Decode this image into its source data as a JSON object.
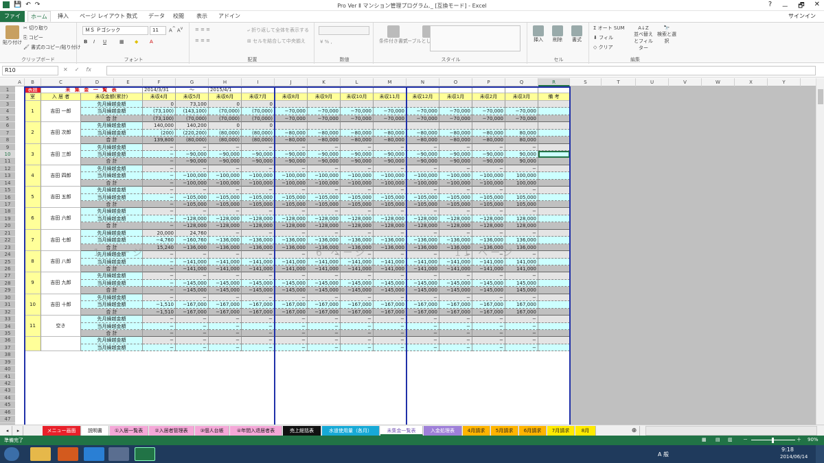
{
  "window": {
    "title": "Pro Ver Ⅱ マンション管理プログラム._ [互換モード] - Excel",
    "signin": "サインイン",
    "min": "－",
    "restore": "🗗",
    "close": "✕",
    "help": "?"
  },
  "ribbon_tabs": [
    "ファイル",
    "ホーム",
    "挿入",
    "ページ レイアウト",
    "数式",
    "データ",
    "校閲",
    "表示",
    "アドイン"
  ],
  "ribbon": {
    "paste": "貼り付け",
    "cut": "切り取り",
    "copy": "コピー",
    "format_painter": "書式のコピー/貼り付け",
    "clipboard": "クリップボード",
    "font_name": "ＭＳ Ｐゴシック",
    "font_size": "11",
    "font": "フォント",
    "wrap": "折り返して全体を表示する",
    "merge": "セルを結合して中央揃え",
    "alignment": "配置",
    "number": "数値",
    "cond_format": "条件付き書式",
    "table_format": "テーブルとして書式設定",
    "style": "スタイル",
    "insert": "挿入",
    "delete": "削除",
    "format": "書式",
    "cells": "セル",
    "autosum": "オート SUM",
    "fill": "フィル",
    "clear": "クリア",
    "sort": "並べ替えとフィルター",
    "find": "検索と選択",
    "editing": "編集"
  },
  "formula_bar": {
    "namebox": "R10",
    "fx": "fx",
    "formula": ""
  },
  "columns": [
    "A",
    "B",
    "C",
    "D",
    "E",
    "F",
    "G",
    "H",
    "I",
    "J",
    "K",
    "L",
    "M",
    "N",
    "O",
    "P",
    "Q",
    "R",
    "S",
    "T",
    "U",
    "V",
    "W",
    "X",
    "Y"
  ],
  "selected_column": "R",
  "selected_row": "10",
  "sheet": {
    "title_mark": "表題",
    "title": "未 集 金 一 覧 表",
    "date_from": "2014/3/31",
    "tilde": "～",
    "date_to": "2015/4/1",
    "hdr_room": "室",
    "hdr_resident": "入 居 者",
    "hdr_amount": "未収金額(累計)",
    "hdr_months": [
      "未収4月",
      "未収5月",
      "未収6月",
      "未収7月",
      "未収8月",
      "未収9月",
      "未収10月",
      "未収11月",
      "未収12月",
      "未収1月",
      "未収2月",
      "未収3月"
    ],
    "hdr_note": "備 考",
    "label_prev": "先月繰越金額",
    "label_curr": "当月繰越金額",
    "label_total": "合 計",
    "watermarks": [
      "1 ページ",
      "6 ページ",
      "11 ページ"
    ],
    "groups": [
      {
        "room": "1",
        "name": "吉田 一郎",
        "rows": [
          [
            "0",
            "73,100",
            "0",
            "0",
            "",
            "",
            "",
            "",
            "",
            "",
            "",
            ""
          ],
          [
            "(73,100)",
            "(143,100)",
            "(70,000)",
            "(70,000)",
            "−70,000",
            "−70,000",
            "−70,000",
            "−70,000",
            "−70,000",
            "−70,000",
            "−70,000",
            "−70,000"
          ],
          [
            "(73,100)",
            "(70,000)",
            "(70,000)",
            "(70,000)",
            "−70,000",
            "−70,000",
            "−70,000",
            "−70,000",
            "−70,000",
            "−70,000",
            "−70,000",
            "−70,000"
          ]
        ]
      },
      {
        "room": "2",
        "name": "吉田 次郎",
        "rows": [
          [
            "140,000",
            "140,200",
            "0",
            "0",
            "",
            "",
            "",
            "",
            "",
            "",
            "",
            ""
          ],
          [
            "(200)",
            "(220,200)",
            "(80,000)",
            "(80,000)",
            "−80,000",
            "−80,000",
            "−80,000",
            "−80,000",
            "−80,000",
            "−80,000",
            "−80,000",
            "80,000"
          ],
          [
            "139,800",
            "(80,000)",
            "(80,000)",
            "(80,000)",
            "−80,000",
            "−80,000",
            "−80,000",
            "−80,000",
            "−80,000",
            "−80,000",
            "−80,000",
            "80,000"
          ]
        ]
      },
      {
        "room": "3",
        "name": "吉田 三郎",
        "rows": [
          [
            "−",
            "−",
            "−",
            "−",
            "−",
            "−",
            "−",
            "−",
            "−",
            "−",
            "−",
            "−"
          ],
          [
            "−",
            "−90,000",
            "−90,000",
            "−90,000",
            "−90,000",
            "−90,000",
            "−90,000",
            "−90,000",
            "−90,000",
            "−90,000",
            "−90,000",
            "90,000"
          ],
          [
            "−",
            "−90,000",
            "−90,000",
            "−90,000",
            "−90,000",
            "−90,000",
            "−90,000",
            "−90,000",
            "−90,000",
            "−90,000",
            "−90,000",
            "90,000"
          ]
        ]
      },
      {
        "room": "4",
        "name": "吉田 四郎",
        "rows": [
          [
            "−",
            "−",
            "−",
            "−",
            "−",
            "−",
            "−",
            "−",
            "−",
            "−",
            "−",
            "−"
          ],
          [
            "−",
            "−100,000",
            "−100,000",
            "−100,000",
            "−100,000",
            "−100,000",
            "−100,000",
            "−100,000",
            "−100,000",
            "−100,000",
            "−100,000",
            "100,000"
          ],
          [
            "−",
            "−100,000",
            "−100,000",
            "−100,000",
            "−100,000",
            "−100,000",
            "−100,000",
            "−100,000",
            "−100,000",
            "−100,000",
            "−100,000",
            "100,000"
          ]
        ]
      },
      {
        "room": "5",
        "name": "吉田 五郎",
        "rows": [
          [
            "−",
            "−",
            "−",
            "−",
            "−",
            "−",
            "−",
            "−",
            "−",
            "−",
            "−",
            "−"
          ],
          [
            "−",
            "−105,000",
            "−105,000",
            "−105,000",
            "−105,000",
            "−105,000",
            "−105,000",
            "−105,000",
            "−105,000",
            "−105,000",
            "−105,000",
            "105,000"
          ],
          [
            "−",
            "−105,000",
            "−105,000",
            "−105,000",
            "−105,000",
            "−105,000",
            "−105,000",
            "−105,000",
            "−105,000",
            "−105,000",
            "−105,000",
            "105,000"
          ]
        ]
      },
      {
        "room": "6",
        "name": "吉田 六郎",
        "rows": [
          [
            "−",
            "−",
            "−",
            "−",
            "−",
            "−",
            "−",
            "−",
            "−",
            "−",
            "−",
            "−"
          ],
          [
            "−",
            "−128,000",
            "−128,000",
            "−128,000",
            "−128,000",
            "−128,000",
            "−128,000",
            "−128,000",
            "−128,000",
            "−128,000",
            "−128,000",
            "128,000"
          ],
          [
            "−",
            "−128,000",
            "−128,000",
            "−128,000",
            "−128,000",
            "−128,000",
            "−128,000",
            "−128,000",
            "−128,000",
            "−128,000",
            "−128,000",
            "128,000"
          ]
        ]
      },
      {
        "room": "7",
        "name": "吉田 七郎",
        "rows": [
          [
            "20,000",
            "24,760",
            "−",
            "−",
            "−",
            "−",
            "−",
            "−",
            "−",
            "−",
            "−",
            "−"
          ],
          [
            "−4,760",
            "−160,760",
            "−136,000",
            "−136,000",
            "−136,000",
            "−136,000",
            "−136,000",
            "−136,000",
            "−136,000",
            "−136,000",
            "−136,000",
            "136,000"
          ],
          [
            "15,240",
            "−136,000",
            "−136,000",
            "−136,000",
            "−136,000",
            "−136,000",
            "−136,000",
            "−136,000",
            "−136,000",
            "−136,000",
            "−136,000",
            "136,000"
          ]
        ]
      },
      {
        "room": "8",
        "name": "吉田 八郎",
        "rows": [
          [
            "−",
            "−",
            "−",
            "−",
            "−",
            "−",
            "−",
            "−",
            "−",
            "−",
            "−",
            "−"
          ],
          [
            "−",
            "−141,000",
            "−141,000",
            "−141,000",
            "−141,000",
            "−141,000",
            "−141,000",
            "−141,000",
            "−141,000",
            "−141,000",
            "−141,000",
            "141,000"
          ],
          [
            "−",
            "−141,000",
            "−141,000",
            "−141,000",
            "−141,000",
            "−141,000",
            "−141,000",
            "−141,000",
            "−141,000",
            "−141,000",
            "−141,000",
            "141,000"
          ]
        ]
      },
      {
        "room": "9",
        "name": "吉田 九郎",
        "rows": [
          [
            "−",
            "−",
            "−",
            "−",
            "−",
            "−",
            "−",
            "−",
            "−",
            "−",
            "−",
            "−"
          ],
          [
            "−",
            "−145,000",
            "−145,000",
            "−145,000",
            "−145,000",
            "−145,000",
            "−145,000",
            "−145,000",
            "−145,000",
            "−145,000",
            "−145,000",
            "145,000"
          ],
          [
            "−",
            "−145,000",
            "−145,000",
            "−145,000",
            "−145,000",
            "−145,000",
            "−145,000",
            "−145,000",
            "−145,000",
            "−145,000",
            "−145,000",
            "145,000"
          ]
        ]
      },
      {
        "room": "10",
        "name": "吉田 十郎",
        "rows": [
          [
            "−",
            "−",
            "−",
            "−",
            "−",
            "−",
            "−",
            "−",
            "−",
            "−",
            "−",
            "−"
          ],
          [
            "−1,510",
            "−167,000",
            "−167,000",
            "−167,000",
            "−167,000",
            "−167,000",
            "−167,000",
            "−167,000",
            "−167,000",
            "−167,000",
            "−167,000",
            "167,000"
          ],
          [
            "−1,510",
            "−167,000",
            "−167,000",
            "−167,000",
            "−167,000",
            "−167,000",
            "−167,000",
            "−167,000",
            "−167,000",
            "−167,000",
            "−167,000",
            "167,000"
          ]
        ]
      },
      {
        "room": "11",
        "name": "空き",
        "rows": [
          [
            "−",
            "−",
            "−",
            "−",
            "−",
            "−",
            "−",
            "−",
            "−",
            "−",
            "−",
            "−"
          ],
          [
            "−",
            "−",
            "−",
            "−",
            "−",
            "−",
            "−",
            "−",
            "−",
            "−",
            "−",
            "−"
          ],
          [
            "−",
            "−",
            "−",
            "−",
            "−",
            "−",
            "−",
            "−",
            "−",
            "−",
            "−",
            "−"
          ]
        ]
      },
      {
        "room": "",
        "name": "",
        "rows": [
          [
            "−",
            "−",
            "−",
            "−",
            "−",
            "−",
            "−",
            "−",
            "−",
            "−",
            "−",
            "−"
          ],
          [
            "−",
            "−",
            "−",
            "−",
            "−",
            "−",
            "−",
            "−",
            "−",
            "−",
            "−",
            "−"
          ]
        ]
      }
    ]
  },
  "sheet_tabs": [
    {
      "label": "メニュー画面",
      "bg": "#e8202a",
      "fg": "#ffffff"
    },
    {
      "label": "説明書",
      "bg": "#ffffff",
      "fg": "#222222"
    },
    {
      "label": "①入居一覧表",
      "bg": "#f4a7d7",
      "fg": "#222222"
    },
    {
      "label": "②入居者管理表",
      "bg": "#f4a7d7",
      "fg": "#222222"
    },
    {
      "label": "③個人台帳",
      "bg": "#f4a7d7",
      "fg": "#222222"
    },
    {
      "label": "④年間入退居者表",
      "bg": "#f4a7d7",
      "fg": "#222222"
    },
    {
      "label": "売上総括表",
      "bg": "#111111",
      "fg": "#ffffff"
    },
    {
      "label": "水道使用量（各月）",
      "bg": "#17a9d6",
      "fg": "#ffffff"
    },
    {
      "label": "未集金一覧表",
      "bg": "#ffffff",
      "fg": "#7a5bb8"
    },
    {
      "label": "入金処理表",
      "bg": "#9e7fd8",
      "fg": "#ffffff"
    },
    {
      "label": "4月請求",
      "bg": "#ffb400",
      "fg": "#222222"
    },
    {
      "label": "5月請求",
      "bg": "#ffb400",
      "fg": "#222222"
    },
    {
      "label": "6月請求",
      "bg": "#ffb400",
      "fg": "#222222"
    },
    {
      "label": "7月請求",
      "bg": "#ffea00",
      "fg": "#222222"
    },
    {
      "label": "8月",
      "bg": "#ffea00",
      "fg": "#222222"
    }
  ],
  "status": {
    "ready": "準備完了",
    "zoom": "90%"
  },
  "taskbar": {
    "time": "9:18",
    "date": "2014/06/14",
    "ime": "A 般"
  },
  "colors": {
    "excel_green": "#217346",
    "yellow": "#ffff99",
    "cyan": "#ccffff",
    "gray": "#c0c0c0",
    "blue_border": "#1f2fa8"
  }
}
